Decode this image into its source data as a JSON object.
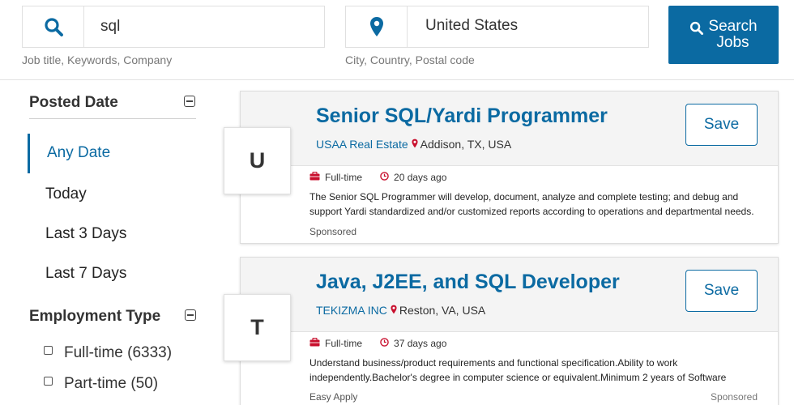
{
  "search": {
    "keyword_value": "sql",
    "keyword_hint": "Job title, Keywords, Company",
    "location_value": "United States",
    "location_hint": "City, Country, Postal code",
    "search_label_line1": "Search",
    "search_label_line2": "Jobs"
  },
  "filters": {
    "posted_date": {
      "title": "Posted Date",
      "options": [
        "Any Date",
        "Today",
        "Last 3 Days",
        "Last 7 Days"
      ],
      "selected": "Any Date"
    },
    "employment_type": {
      "title": "Employment Type",
      "options": [
        "Full-time (6333)",
        "Part-time (50)"
      ]
    }
  },
  "jobs": [
    {
      "logo_letter": "U",
      "title": "Senior SQL/Yardi Programmer",
      "company": "USAA Real Estate",
      "location": "Addison, TX, USA",
      "type": "Full-time",
      "posted": "20 days ago",
      "description": "The Senior SQL Programmer will develop, document, analyze and complete testing; and debug and support Yardi standardized and/or customized reports according to operations and departmental needs.",
      "footer_left": "Sponsored",
      "footer_right": "",
      "save_label": "Save"
    },
    {
      "logo_letter": "T",
      "title": "Java, J2EE, and SQL Developer",
      "company": "TEKIZMA INC",
      "location": "Reston, VA, USA",
      "type": "Full-time",
      "posted": "37 days ago",
      "description": "Understand business/product requirements and functional specification.Ability to work independently.Bachelor's degree in computer science or equivalent.Minimum 2 years of Software",
      "footer_left": "Easy Apply",
      "footer_right": "Sponsored",
      "save_label": "Save"
    }
  ],
  "colors": {
    "accent": "#0b6aa2",
    "briefcase": "#c8102e",
    "clock": "#c8102e",
    "pin": "#c8102e"
  }
}
